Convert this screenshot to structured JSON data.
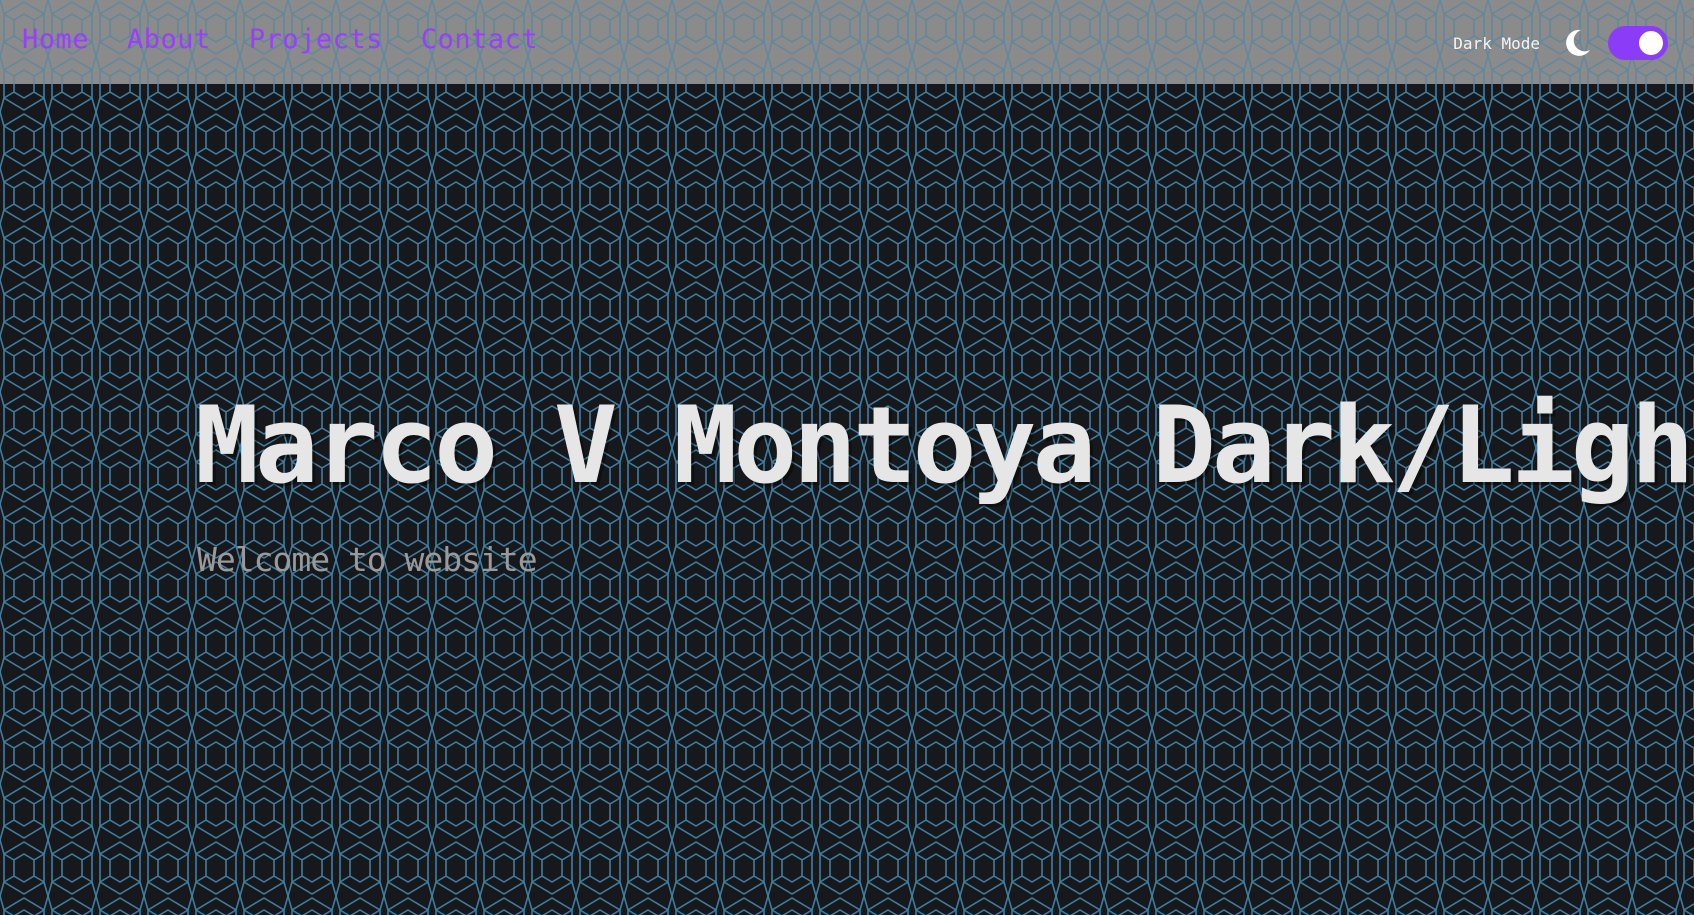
{
  "nav": {
    "links": [
      "Home",
      "About",
      "Projects",
      "Contact"
    ]
  },
  "theme_toggle": {
    "label": "Dark Mode",
    "icon": "moon-icon",
    "state": "on"
  },
  "hero": {
    "title": "Marco V Montoya Dark/Light",
    "subtitle": "Welcome to website"
  },
  "colors": {
    "background": "#16181b",
    "pattern_line": "#3f7ea0",
    "navbar": "#969696",
    "nav_link": "#9b3cff",
    "toggle_track": "#8b3cf7",
    "title": "#e6e6e6",
    "subtitle": "#9a9a9a"
  }
}
